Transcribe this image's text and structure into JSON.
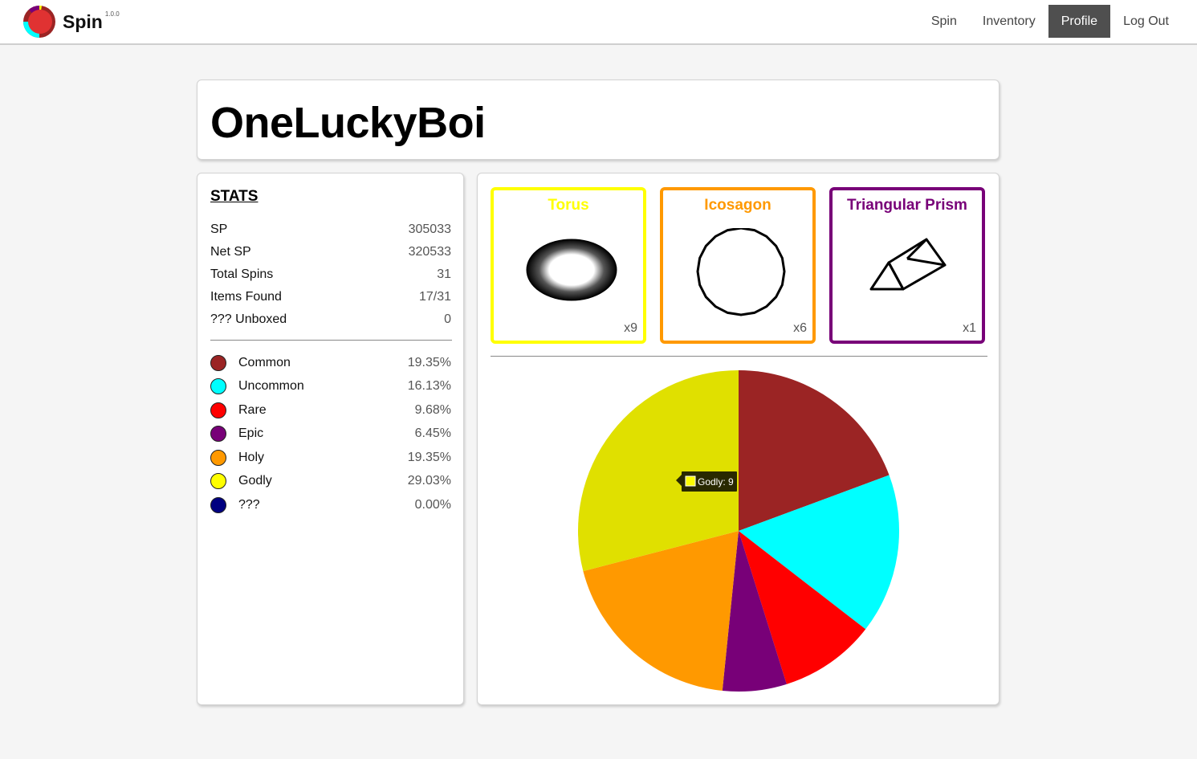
{
  "nav": {
    "brand": "Spin",
    "version": "1.0.0",
    "links": [
      "Spin",
      "Inventory",
      "Profile",
      "Log Out"
    ],
    "active": "Profile"
  },
  "profile": {
    "username": "OneLuckyBoi"
  },
  "stats": {
    "heading": "STATS",
    "rows": [
      {
        "label": "SP",
        "value": "305033"
      },
      {
        "label": "Net SP",
        "value": "320533"
      },
      {
        "label": "Total Spins",
        "value": "31"
      },
      {
        "label": "Items Found",
        "value": "17/31"
      },
      {
        "label": "??? Unboxed",
        "value": "0"
      }
    ],
    "rarities": [
      {
        "name": "Common",
        "percent": "19.35%",
        "color": "#9b2424"
      },
      {
        "name": "Uncommon",
        "percent": "16.13%",
        "color": "#00ffff"
      },
      {
        "name": "Rare",
        "percent": "9.68%",
        "color": "#ff0000"
      },
      {
        "name": "Epic",
        "percent": "6.45%",
        "color": "#780078"
      },
      {
        "name": "Holy",
        "percent": "19.35%",
        "color": "#ff9900"
      },
      {
        "name": "Godly",
        "percent": "29.03%",
        "color": "#ffff00"
      },
      {
        "name": "???",
        "percent": "0.00%",
        "color": "#000080"
      }
    ]
  },
  "top_items": [
    {
      "name": "Torus",
      "count": "x9",
      "color": "#ffff00",
      "icon": "torus-icon"
    },
    {
      "name": "Icosagon",
      "count": "x6",
      "color": "#ff9900",
      "icon": "icosagon-icon"
    },
    {
      "name": "Triangular Prism",
      "count": "x1",
      "color": "#780078",
      "icon": "triangular-prism-icon"
    }
  ],
  "chart_data": {
    "type": "pie",
    "labels": [
      "Common",
      "Uncommon",
      "Rare",
      "Epic",
      "Holy",
      "Godly",
      "???"
    ],
    "values": [
      6,
      5,
      3,
      2,
      6,
      9,
      0
    ],
    "colors": [
      "#9b2424",
      "#00ffff",
      "#ff0000",
      "#780078",
      "#ff9900",
      "#e0e000",
      "#000080"
    ],
    "tooltip": {
      "label": "Godly",
      "text": "Godly: 9",
      "swatch": "#ffff00"
    }
  }
}
